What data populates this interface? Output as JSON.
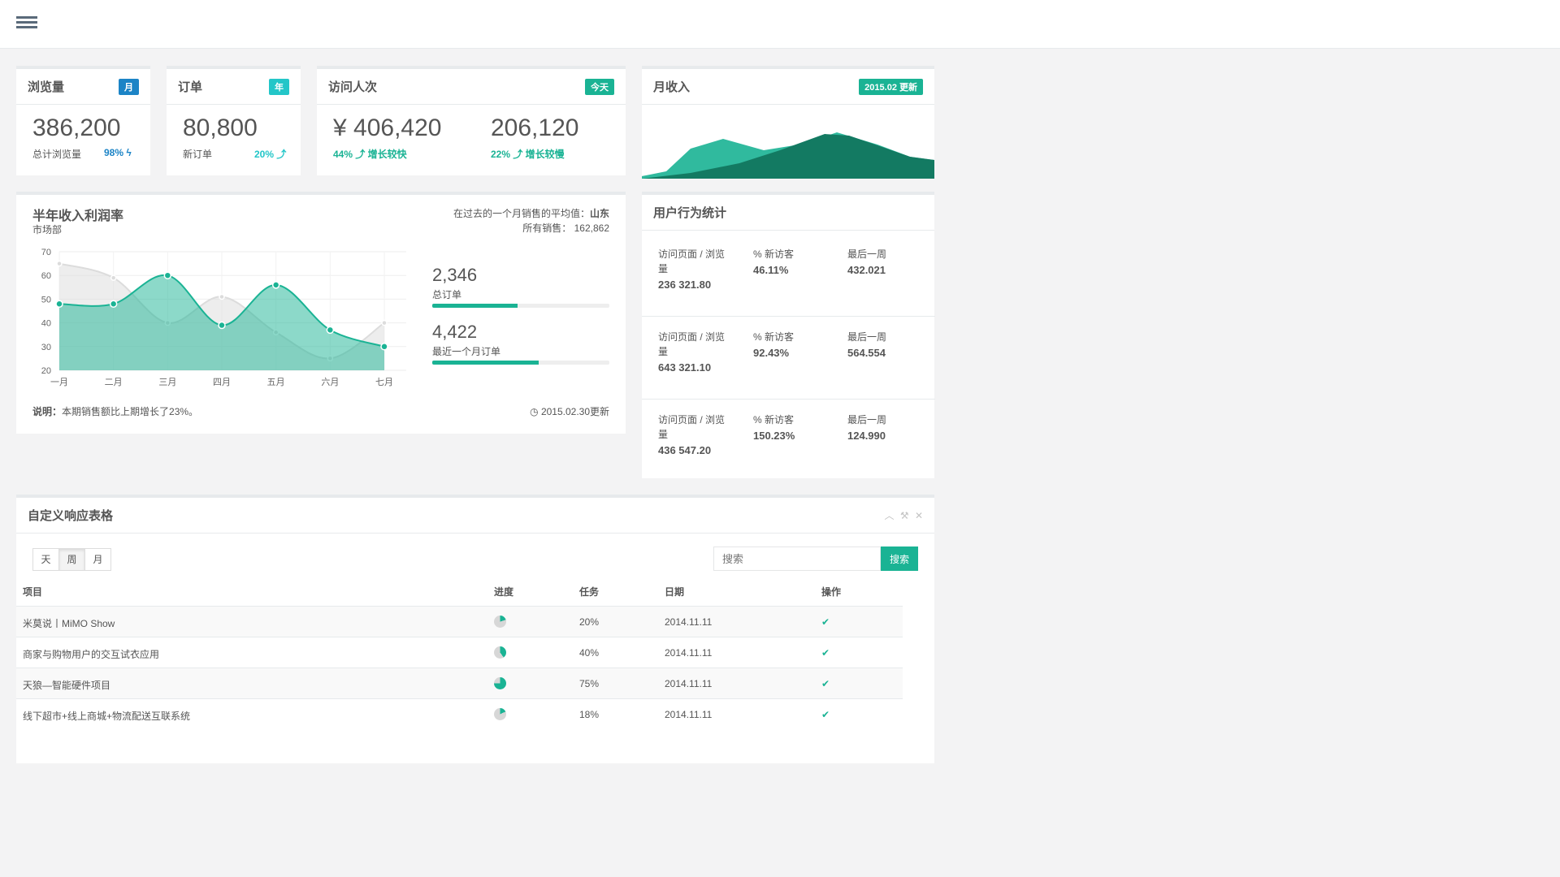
{
  "header": {
    "menu_icon": "list-icon"
  },
  "stats": [
    {
      "title": "浏览量",
      "badge": "月",
      "value": "386,200",
      "sub": "总计浏览量",
      "pct": "98% ϟ"
    },
    {
      "title": "订单",
      "badge": "年",
      "value": "80,800",
      "sub": "新订单",
      "pct": "20% ⤴"
    },
    {
      "title": "访问人次",
      "badge": "今天",
      "value1": "¥ 406,420",
      "pct1": "44% ⤴ 增长较快",
      "value2": "206,120",
      "pct2": "22% ⤴ 增长较慢"
    },
    {
      "title": "月收入",
      "badge": "2015.02 更新"
    }
  ],
  "profit": {
    "title": "半年收入利润率",
    "subtitle": "市场部",
    "avg_label": "在过去的一个月销售的平均值：",
    "avg_value": "山东",
    "total_label": "所有销售：",
    "total_value": "162,862",
    "orders_value": "2,346",
    "orders_label": "总订单",
    "orders_progress": 0.48,
    "recent_value": "4,422",
    "recent_label": "最近一个月订单",
    "recent_progress": 0.6,
    "note_label": "说明：",
    "note_text": "本期销售额比上期增长了23%。",
    "updated": "2015.02.30更新"
  },
  "chart_data": {
    "type": "area",
    "categories": [
      "一月",
      "二月",
      "三月",
      "四月",
      "五月",
      "六月",
      "七月"
    ],
    "ylim": [
      20,
      70
    ],
    "yticks": [
      20,
      30,
      40,
      50,
      60,
      70
    ],
    "series": [
      {
        "values": [
          65,
          59,
          40,
          51,
          36,
          25,
          40
        ],
        "color": "#dcdcdc"
      },
      {
        "values": [
          48,
          48,
          60,
          39,
          56,
          37,
          30
        ],
        "color": "#1ab394"
      }
    ]
  },
  "behavior": {
    "title": "用户行为统计",
    "rows": [
      {
        "c1_label": "访问页面 / 浏览量",
        "c1_value": "236 321.80",
        "c2_label": "% 新访客",
        "c2_value": "46.11%",
        "c3_label": "最后一周",
        "c3_value": "432.021"
      },
      {
        "c1_label": "访问页面 / 浏览量",
        "c1_value": "643 321.10",
        "c2_label": "% 新访客",
        "c2_value": "92.43%",
        "c3_label": "最后一周",
        "c3_value": "564.554"
      },
      {
        "c1_label": "访问页面 / 浏览量",
        "c1_value": "436 547.20",
        "c2_label": "% 新访客",
        "c2_value": "150.23%",
        "c3_label": "最后一周",
        "c3_value": "124.990"
      }
    ]
  },
  "table": {
    "title": "自定义响应表格",
    "segments": [
      "天",
      "周",
      "月"
    ],
    "active_segment": "周",
    "search_placeholder": "搜索",
    "search_button": "搜索",
    "headers": [
      "项目",
      "进度",
      "任务",
      "日期",
      "操作"
    ],
    "rows": [
      {
        "project": "米莫说丨MiMO Show",
        "progress": 0.2,
        "task": "20%",
        "date": "2014.11.11"
      },
      {
        "project": "商家与购物用户的交互试衣应用",
        "progress": 0.4,
        "task": "40%",
        "date": "2014.11.11"
      },
      {
        "project": "天狼—智能硬件项目",
        "progress": 0.75,
        "task": "75%",
        "date": "2014.11.11"
      },
      {
        "project": "线下超市+线上商城+物流配送互联系统",
        "progress": 0.18,
        "task": "18%",
        "date": "2014.11.11"
      }
    ]
  },
  "colors": {
    "accent": "#1ab394",
    "blue": "#1c84c6",
    "cyan": "#23c6c8"
  }
}
